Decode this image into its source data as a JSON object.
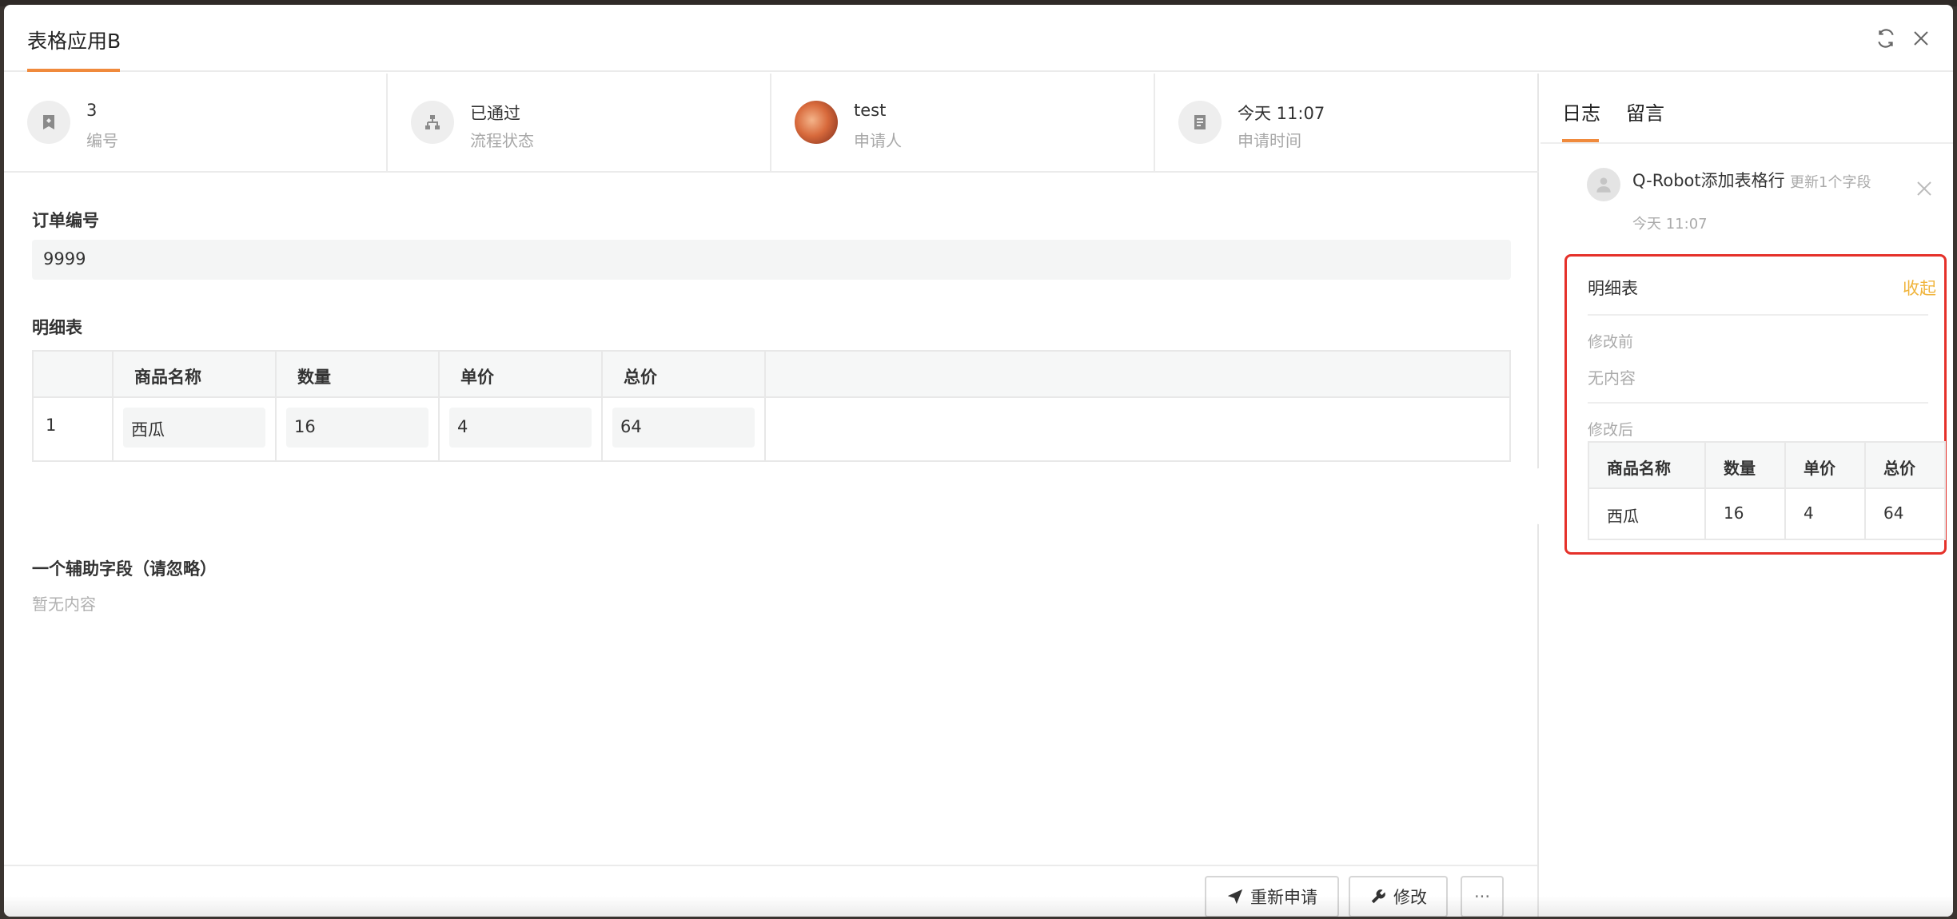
{
  "header": {
    "title": "表格应用B"
  },
  "info": [
    {
      "value": "3",
      "label": "编号",
      "icon": "bookmark-icon"
    },
    {
      "value": "已通过",
      "label": "流程状态",
      "icon": "flow-icon"
    },
    {
      "value": "test",
      "label": "申请人",
      "icon": "avatar"
    },
    {
      "value": "今天 11:07",
      "label": "申请时间",
      "icon": "form-icon"
    }
  ],
  "form": {
    "order_label": "订单编号",
    "order_value": "9999",
    "detail_label": "明细表",
    "detail_table": {
      "headers": [
        "商品名称",
        "数量",
        "单价",
        "总价"
      ],
      "rows": [
        {
          "index": "1",
          "cells": [
            "西瓜",
            "16",
            "4",
            "64"
          ]
        }
      ]
    },
    "aux_label": "一个辅助字段（请忽略）",
    "aux_value": "暂无内容"
  },
  "footer": {
    "reapply_label": "重新申请",
    "edit_label": "修改",
    "more_label": "···"
  },
  "side": {
    "tabs": [
      "日志",
      "留言"
    ],
    "log": {
      "title": "Q-Robot添加表格行",
      "sub": "更新1个字段",
      "time": "今天 11:07",
      "box_title": "明细表",
      "collapse_label": "收起",
      "before_label": "修改前",
      "before_value": "无内容",
      "after_label": "修改后",
      "table": {
        "headers": [
          "商品名称",
          "数量",
          "单价",
          "总价"
        ],
        "row": [
          "西瓜",
          "16",
          "4",
          "64"
        ]
      }
    }
  },
  "colors": {
    "accent": "#f08a3c",
    "highlight": "#e5312a",
    "collapse": "#f0b43c"
  }
}
